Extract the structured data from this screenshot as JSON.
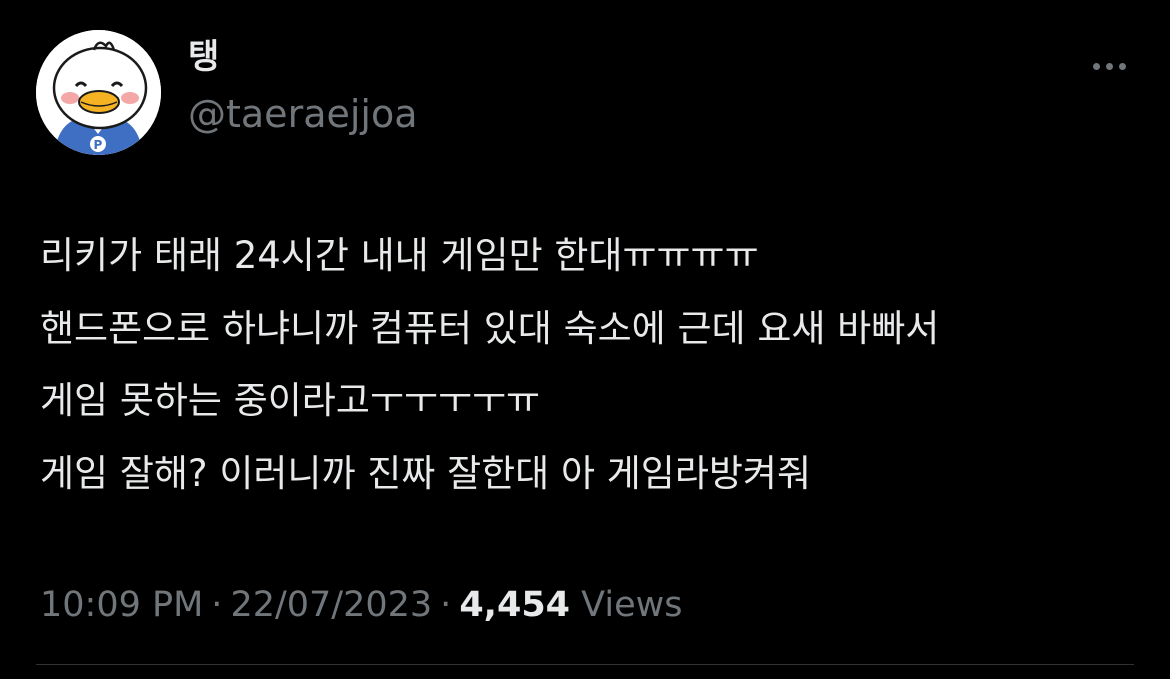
{
  "colors": {
    "background": "#000000",
    "primary_text": "#e7e9ea",
    "secondary_text": "#71767b",
    "divider": "#2f3336"
  },
  "author": {
    "display_name": "탱",
    "handle": "@taeraejjoa",
    "avatar_icon": "duck-avatar-icon"
  },
  "more_icon": "more-options-icon",
  "tweet": {
    "lines": [
      "리키가 태래 24시간 내내 게임만 한대ㅠㅠㅠㅠ",
      "핸드폰으로 하냐니까 컴퓨터 있대 숙소에 근데 요새 바빠서",
      "게임 못하는 중이라고ㅜㅜㅜㅜㅠ",
      "게임 잘해? 이러니까 진짜 잘한대 아 게임라방켜줘"
    ]
  },
  "meta": {
    "time": "10:09 PM",
    "separator": "·",
    "date": "22/07/2023",
    "views_count": "4,454",
    "views_label": "Views"
  }
}
